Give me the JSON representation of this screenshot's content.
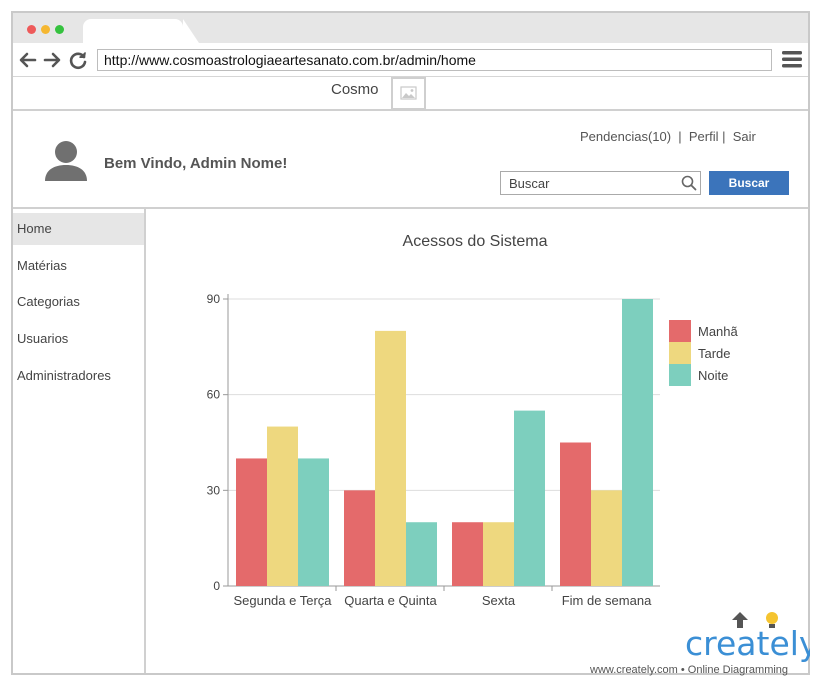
{
  "browser": {
    "url": "http://www.cosmoastrologiaeartesanato.com.br/admin/home"
  },
  "site": {
    "name": "Cosmo",
    "logo_icon": "image-placeholder-icon"
  },
  "header": {
    "welcome": "Bem Vindo, Admin Nome!",
    "links": {
      "pendencias": "Pendencias(10)",
      "sep1": "  |  ",
      "perfil": "Perfil",
      "sep2": " |  ",
      "sair": "Sair"
    },
    "search_placeholder": "Buscar",
    "search_button": "Buscar"
  },
  "sidebar": {
    "items": [
      {
        "label": "Home",
        "active": true
      },
      {
        "label": "Matérias"
      },
      {
        "label": "Categorias"
      },
      {
        "label": "Usuarios"
      },
      {
        "label": "Administradores"
      }
    ]
  },
  "chart_data": {
    "type": "bar",
    "title": "Acessos do Sistema",
    "categories": [
      "Segunda e Terça",
      "Quarta e Quinta",
      "Sexta",
      "Fim de semana"
    ],
    "category_labels_shown": [
      "Segunda e Terça",
      "Quarta e Quinta",
      "Sexta",
      "Fim de semana"
    ],
    "series": [
      {
        "name": "Manhã",
        "values": [
          40,
          30,
          20,
          45
        ],
        "color": "#e46a6b"
      },
      {
        "name": "Tarde",
        "values": [
          50,
          80,
          20,
          30
        ],
        "color": "#eed87f"
      },
      {
        "name": "Noite",
        "values": [
          40,
          20,
          55,
          90
        ],
        "color": "#7dcfbe"
      }
    ],
    "yticks": [
      0,
      30,
      60,
      90
    ],
    "ylim": [
      0,
      90
    ],
    "grid": true,
    "legend": "right"
  },
  "watermark": {
    "brand": "creately",
    "tagline": "www.creately.com • Online Diagramming"
  },
  "colors": {
    "accent": "#3b74bb"
  }
}
